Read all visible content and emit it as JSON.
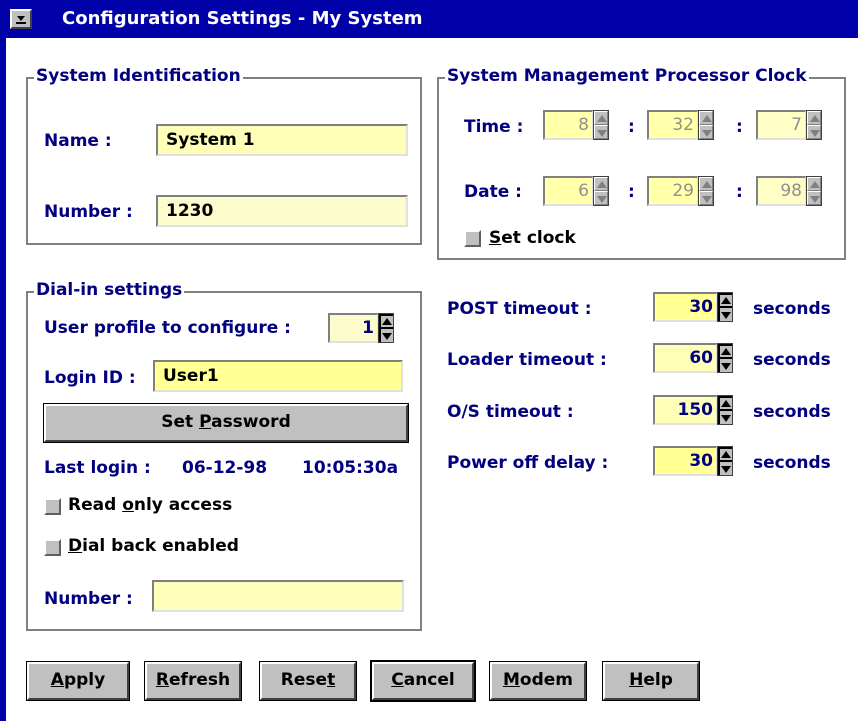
{
  "window": {
    "title": "Configuration Settings - My System"
  },
  "system_identification": {
    "legend": "System Identification",
    "name_label": "Name :",
    "name_value": "System 1",
    "number_label": "Number :",
    "number_value": "1230"
  },
  "clock": {
    "legend": "System Management Processor Clock",
    "time_label": "Time :",
    "time_values": [
      "8",
      "32",
      "7"
    ],
    "date_label": "Date :",
    "date_values": [
      "6",
      "29",
      "98"
    ],
    "separator": ":",
    "set_clock": {
      "pre": "",
      "accel": "S",
      "post": "et clock",
      "checked": false
    }
  },
  "dialin": {
    "legend": "Dial-in settings",
    "profile_label": "User profile to configure :",
    "profile_value": "1",
    "login_label": "Login ID :",
    "login_value": "User1",
    "set_password": {
      "pre": "Set ",
      "accel": "P",
      "post": "assword"
    },
    "last_login_label": "Last login :",
    "last_login_date": "06-12-98",
    "last_login_time": "10:05:30a",
    "read_only": {
      "pre": "Read ",
      "accel": "o",
      "post": "nly access",
      "checked": false
    },
    "dial_back": {
      "pre": "",
      "accel": "D",
      "post": "ial back enabled",
      "checked": false
    },
    "number_label": "Number :",
    "number_value": ""
  },
  "timeouts": {
    "unit": "seconds",
    "items": [
      {
        "label": "POST timeout :",
        "value": "30"
      },
      {
        "label": "Loader timeout :",
        "value": "60"
      },
      {
        "label": "O/S timeout :",
        "value": "150"
      },
      {
        "label": "Power off delay :",
        "value": "30"
      }
    ]
  },
  "buttons": {
    "apply": {
      "pre": "",
      "accel": "A",
      "post": "pply"
    },
    "refresh": {
      "pre": "",
      "accel": "R",
      "post": "efresh"
    },
    "reset": {
      "pre": "Rese",
      "accel": "t",
      "post": ""
    },
    "cancel": {
      "pre": "",
      "accel": "C",
      "post": "ancel"
    },
    "modem": {
      "pre": "",
      "accel": "M",
      "post": "odem"
    },
    "help": {
      "pre": "",
      "accel": "H",
      "post": "elp"
    }
  },
  "colors": {
    "title_bar": "#0000a8",
    "label_text": "#000080",
    "field_fill": "#ffff90",
    "button_face": "#c0c0c0"
  }
}
